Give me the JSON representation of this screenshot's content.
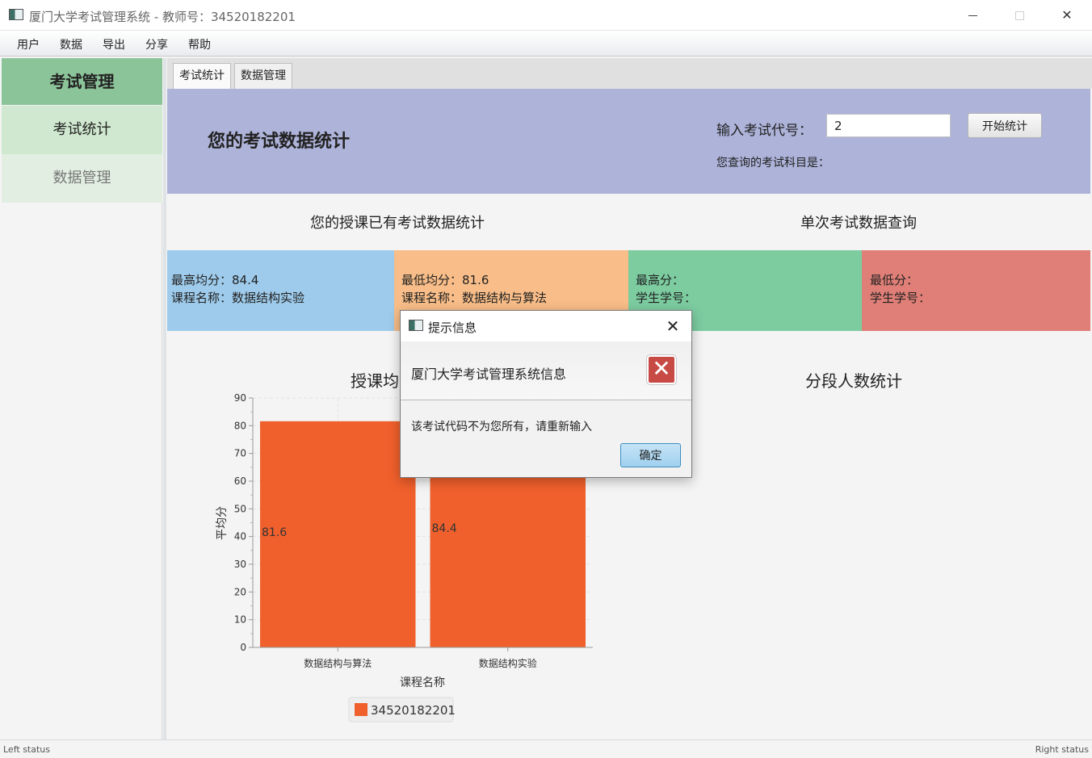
{
  "window": {
    "title": "厦门大学考试管理系统 - 教师号：34520182201",
    "icon": "app-window-icon"
  },
  "menu": [
    "用户",
    "数据",
    "导出",
    "分享",
    "帮助"
  ],
  "sidebar": {
    "header": "考试管理",
    "items": [
      {
        "label": "考试统计"
      },
      {
        "label": "数据管理"
      }
    ]
  },
  "tabs": [
    "考试统计",
    "数据管理"
  ],
  "panel": {
    "title": "您的考试数据统计",
    "code_label": "输入考试代号：",
    "code_value": "2",
    "start_button": "开始统计",
    "subject_label": "您查询的考试科目是："
  },
  "sections": {
    "left": "您的授课已有考试数据统计",
    "right": "单次考试数据查询"
  },
  "cards": [
    {
      "line1": "最高均分：84.4",
      "line2": "课程名称：数据结构实验",
      "color": "#9ecbeb"
    },
    {
      "line1": "最低均分：81.6",
      "line2": "课程名称：数据结构与算法",
      "color": "#f8bd88"
    },
    {
      "line1": "最高分：",
      "line2": "学生学号：",
      "color": "#7ccca0"
    },
    {
      "line1": "最低分：",
      "line2": "学生学号：",
      "color": "#e07f77"
    }
  ],
  "chart_titles": {
    "left": "授课均",
    "right": "分段人数统计"
  },
  "chart_data": {
    "type": "bar",
    "categories": [
      "数据结构与算法",
      "数据结构实验"
    ],
    "series": [
      {
        "name": "34520182201",
        "values": [
          81.6,
          84.4
        ],
        "color": "#f0602c"
      }
    ],
    "xlabel": "课程名称",
    "ylabel": "平均分",
    "ylim": [
      0,
      90
    ],
    "yticks": [
      0,
      10,
      20,
      30,
      40,
      50,
      60,
      70,
      80,
      90
    ],
    "legend": "bottom",
    "grid": true
  },
  "status": {
    "left": "Left status",
    "right": "Right status"
  },
  "dialog": {
    "title": "提示信息",
    "header": "厦门大学考试管理系统信息",
    "message": "该考试代码不为您所有，请重新输入",
    "ok": "确定",
    "error_icon": "error-x-icon"
  }
}
